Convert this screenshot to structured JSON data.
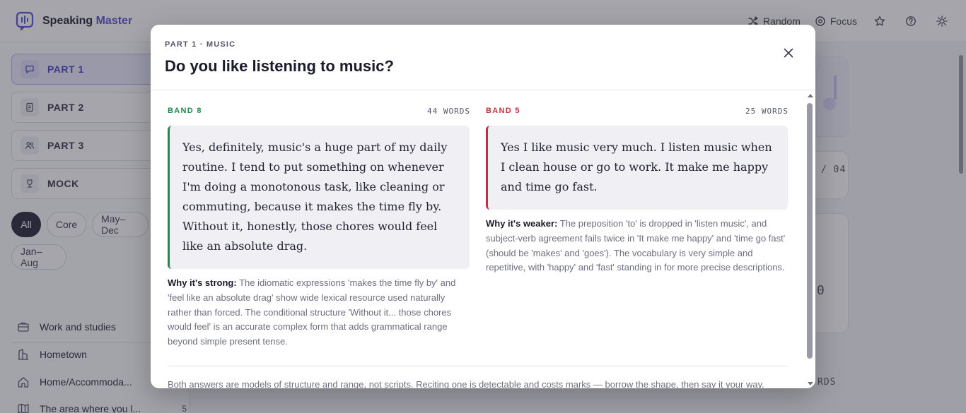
{
  "app": {
    "brand_prefix": "Speaking",
    "brand_accent": "Master",
    "actions": {
      "random": "Random",
      "focus": "Focus"
    }
  },
  "sidebar": {
    "parts": [
      {
        "label": "PART 1",
        "icon": "chat-bubble-icon",
        "active": true
      },
      {
        "label": "PART 2",
        "icon": "document-icon",
        "active": false
      },
      {
        "label": "PART 3",
        "icon": "people-icon",
        "active": false
      },
      {
        "label": "MOCK",
        "icon": "trophy-icon",
        "active": false
      }
    ],
    "filters": [
      "All",
      "Core",
      "May–Dec",
      "Jan–Aug"
    ],
    "active_filter": "All",
    "topics": [
      {
        "label": "Work and studies",
        "icon": "briefcase-icon",
        "count": ""
      },
      {
        "label": "Hometown",
        "icon": "buildings-icon",
        "count": ""
      },
      {
        "label": "Home/Accommoda...",
        "icon": "home-icon",
        "count": ""
      },
      {
        "label": "The area where you l...",
        "icon": "map-icon",
        "count": "5"
      }
    ]
  },
  "background_main": {
    "counter_text": "/ 04",
    "score_text": "0",
    "words_text": "RDS"
  },
  "modal": {
    "eyebrow": "PART 1 · MUSIC",
    "title": "Do you like listening to music?",
    "good": {
      "band": "BAND 8",
      "words": "44 WORDS",
      "answer": "Yes, definitely, music's a huge part of my daily routine. I tend to put something on whenever I'm doing a monotonous task, like cleaning or commuting, because it makes the time fly by. Without it, honestly, those chores would feel like an absolute drag.",
      "explain_label": "Why it's strong:",
      "explain_text": " The idiomatic expressions 'makes the time fly by' and 'feel like an absolute drag' show wide lexical resource used naturally rather than forced. The conditional structure 'Without it... those chores would feel' is an accurate complex form that adds grammatical range beyond simple present tense."
    },
    "weak": {
      "band": "BAND 5",
      "words": "25 WORDS",
      "answer": "Yes I like music very much. I listen music when I clean house or go to work. It make me happy and time go fast.",
      "explain_label": "Why it's weaker:",
      "explain_text": " The preposition 'to' is dropped in 'listen music', and subject-verb agreement fails twice in 'It make me happy' and 'time go fast' (should be 'makes' and 'goes'). The vocabulary is very simple and repetitive, with 'happy' and 'fast' standing in for more precise descriptions."
    },
    "footnote": "Both answers are models of structure and range, not scripts. Reciting one is detectable and costs marks — borrow the shape, then say it your way."
  },
  "colors": {
    "accent": "#5b55d6",
    "band_good": "#1f8a4c",
    "band_bad": "#c0313f"
  }
}
